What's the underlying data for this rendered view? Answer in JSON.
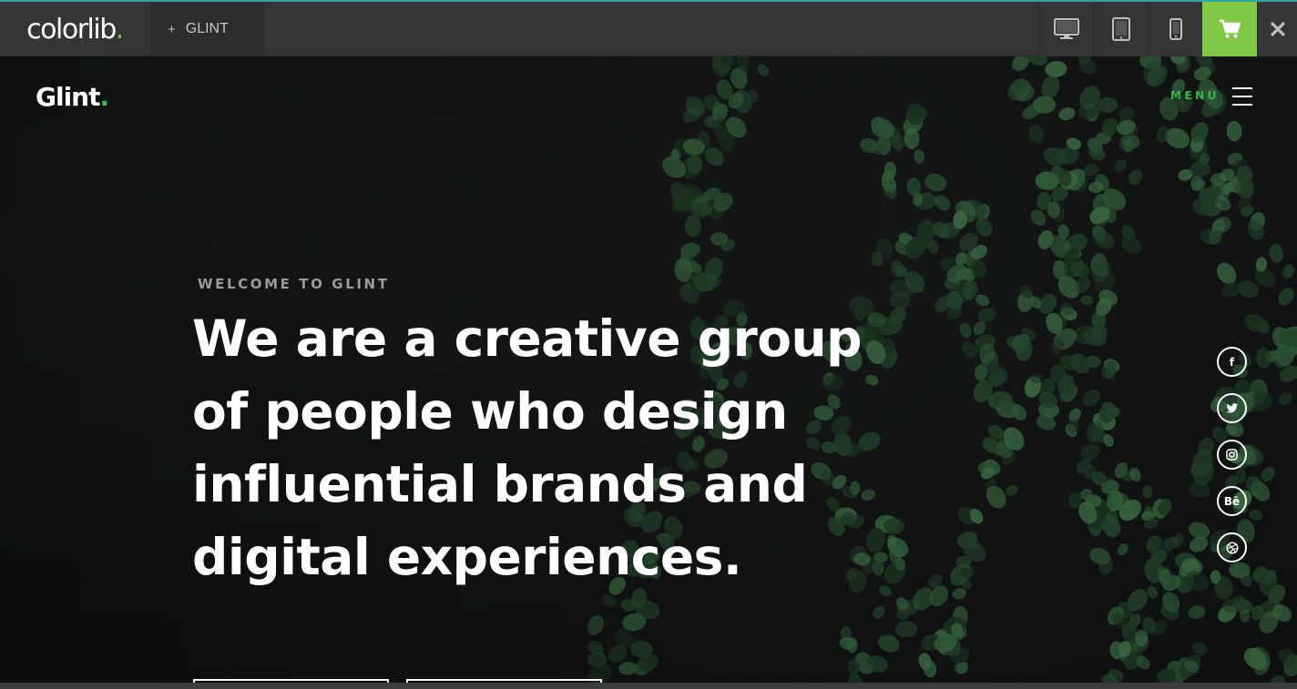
{
  "preview_bar": {
    "brand_text": "colorlib",
    "brand_dot": ".",
    "theme_tab_plus": "+",
    "theme_tab_label": "GLINT",
    "accent_color": "#7ec845",
    "devices": [
      "desktop-icon",
      "tablet-icon",
      "mobile-icon"
    ],
    "cart_icon": "cart-icon",
    "close_icon": "close-icon"
  },
  "site": {
    "logo_text": "Glint",
    "logo_dot": ".",
    "menu_label": "MENU",
    "accent_color": "#39b54a"
  },
  "hero": {
    "kicker": "WELCOME TO GLINT",
    "headline_lines": [
      "We are a creative group",
      "of people who design",
      "influential brands and",
      "digital experiences."
    ]
  },
  "social": [
    {
      "icon": "facebook-icon",
      "label": "f"
    },
    {
      "icon": "twitter-icon",
      "label": ""
    },
    {
      "icon": "instagram-icon",
      "label": ""
    },
    {
      "icon": "behance-icon",
      "label": "Bē"
    },
    {
      "icon": "dribbble-icon",
      "label": ""
    }
  ]
}
